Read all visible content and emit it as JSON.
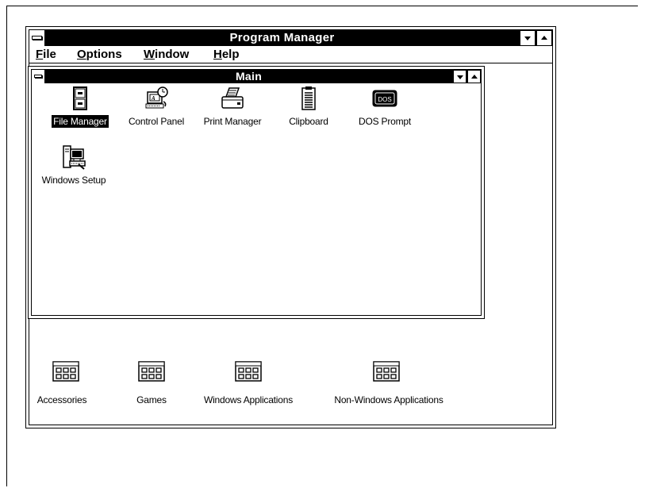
{
  "program_manager": {
    "title": "Program Manager",
    "menu": [
      {
        "accel": "F",
        "rest": "ile"
      },
      {
        "accel": "O",
        "rest": "ptions"
      },
      {
        "accel": "W",
        "rest": "indow"
      },
      {
        "accel": "H",
        "rest": "elp"
      }
    ]
  },
  "main_group": {
    "title": "Main",
    "items": [
      {
        "label": "File Manager",
        "icon": "file-cabinet-icon",
        "selected": true
      },
      {
        "label": "Control Panel",
        "icon": "control-panel-icon"
      },
      {
        "label": "Print Manager",
        "icon": "printer-icon"
      },
      {
        "label": "Clipboard",
        "icon": "clipboard-icon"
      },
      {
        "label": "DOS Prompt",
        "icon": "dos-prompt-icon",
        "icon_text": "DOS"
      },
      {
        "label": "Windows Setup",
        "icon": "windows-setup-icon"
      }
    ]
  },
  "minimized_groups": [
    {
      "label": "Accessories",
      "icon": "program-group-icon"
    },
    {
      "label": "Games",
      "icon": "program-group-icon"
    },
    {
      "label": "Windows Applications",
      "icon": "program-group-icon"
    },
    {
      "label": "Non-Windows Applications",
      "icon": "program-group-icon"
    }
  ]
}
